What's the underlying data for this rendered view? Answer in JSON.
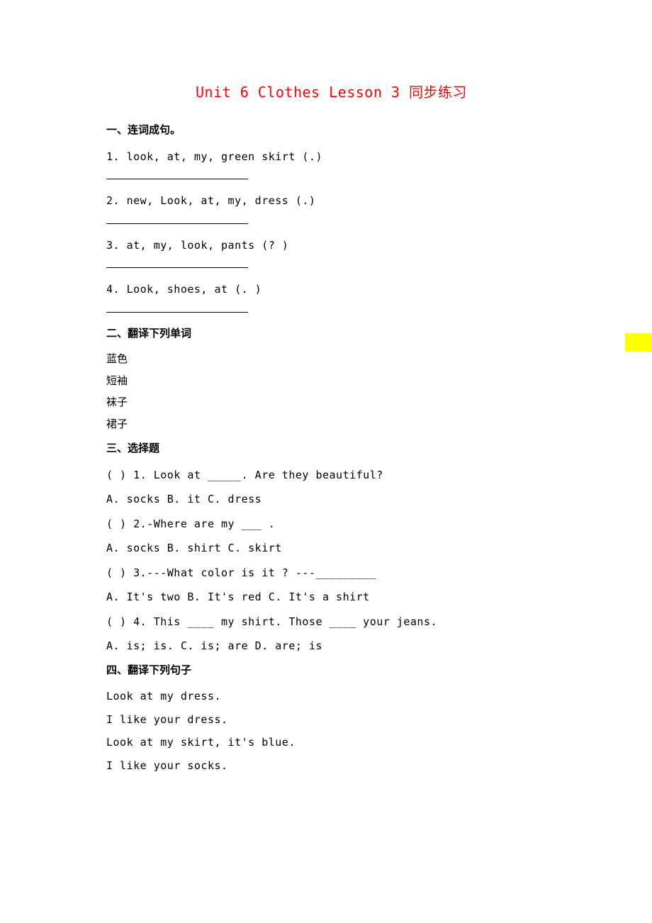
{
  "title": "Unit 6 Clothes Lesson 3 同步练习",
  "section1": {
    "heading": "一、连词成句。",
    "q1": "1. look, at,   my,   green skirt    (.)",
    "q2": "2. new,   Look,   at,   my,   dress  (.)",
    "q3": "3. at, my, look, pants    (? )",
    "q4": "4. Look,  shoes,   at   (. )"
  },
  "section2": {
    "heading": "二、翻译下列单词",
    "w1": "蓝色",
    "w2": "短袖",
    "w3": "袜子",
    "w4": "裙子"
  },
  "section3": {
    "heading": "三、选择题",
    "q1": "(     ) 1. Look at _____. Are they beautiful?",
    "q1_opts": "A. socks           B. it          C. dress",
    "q2": "(     ) 2.-Where are my ___ .",
    "q2_opts": "A. socks           B. shirt       C. skirt",
    "q3": "(     ) 3.---What color is it ?   ---_________",
    "q3_opts": "A.  It's two      B. It's red   C. It's a shirt",
    "q4": "(     ) 4. This ____ my shirt. Those ____ your jeans.",
    "q4_opts": "A. is; is.       C. is; are      D. are; is"
  },
  "section4": {
    "heading": "四、翻译下列句子",
    "s1": "Look at my dress.",
    "s2": "I like your dress.",
    "s3": "Look at my skirt, it's blue.",
    "s4": "I like your socks."
  }
}
